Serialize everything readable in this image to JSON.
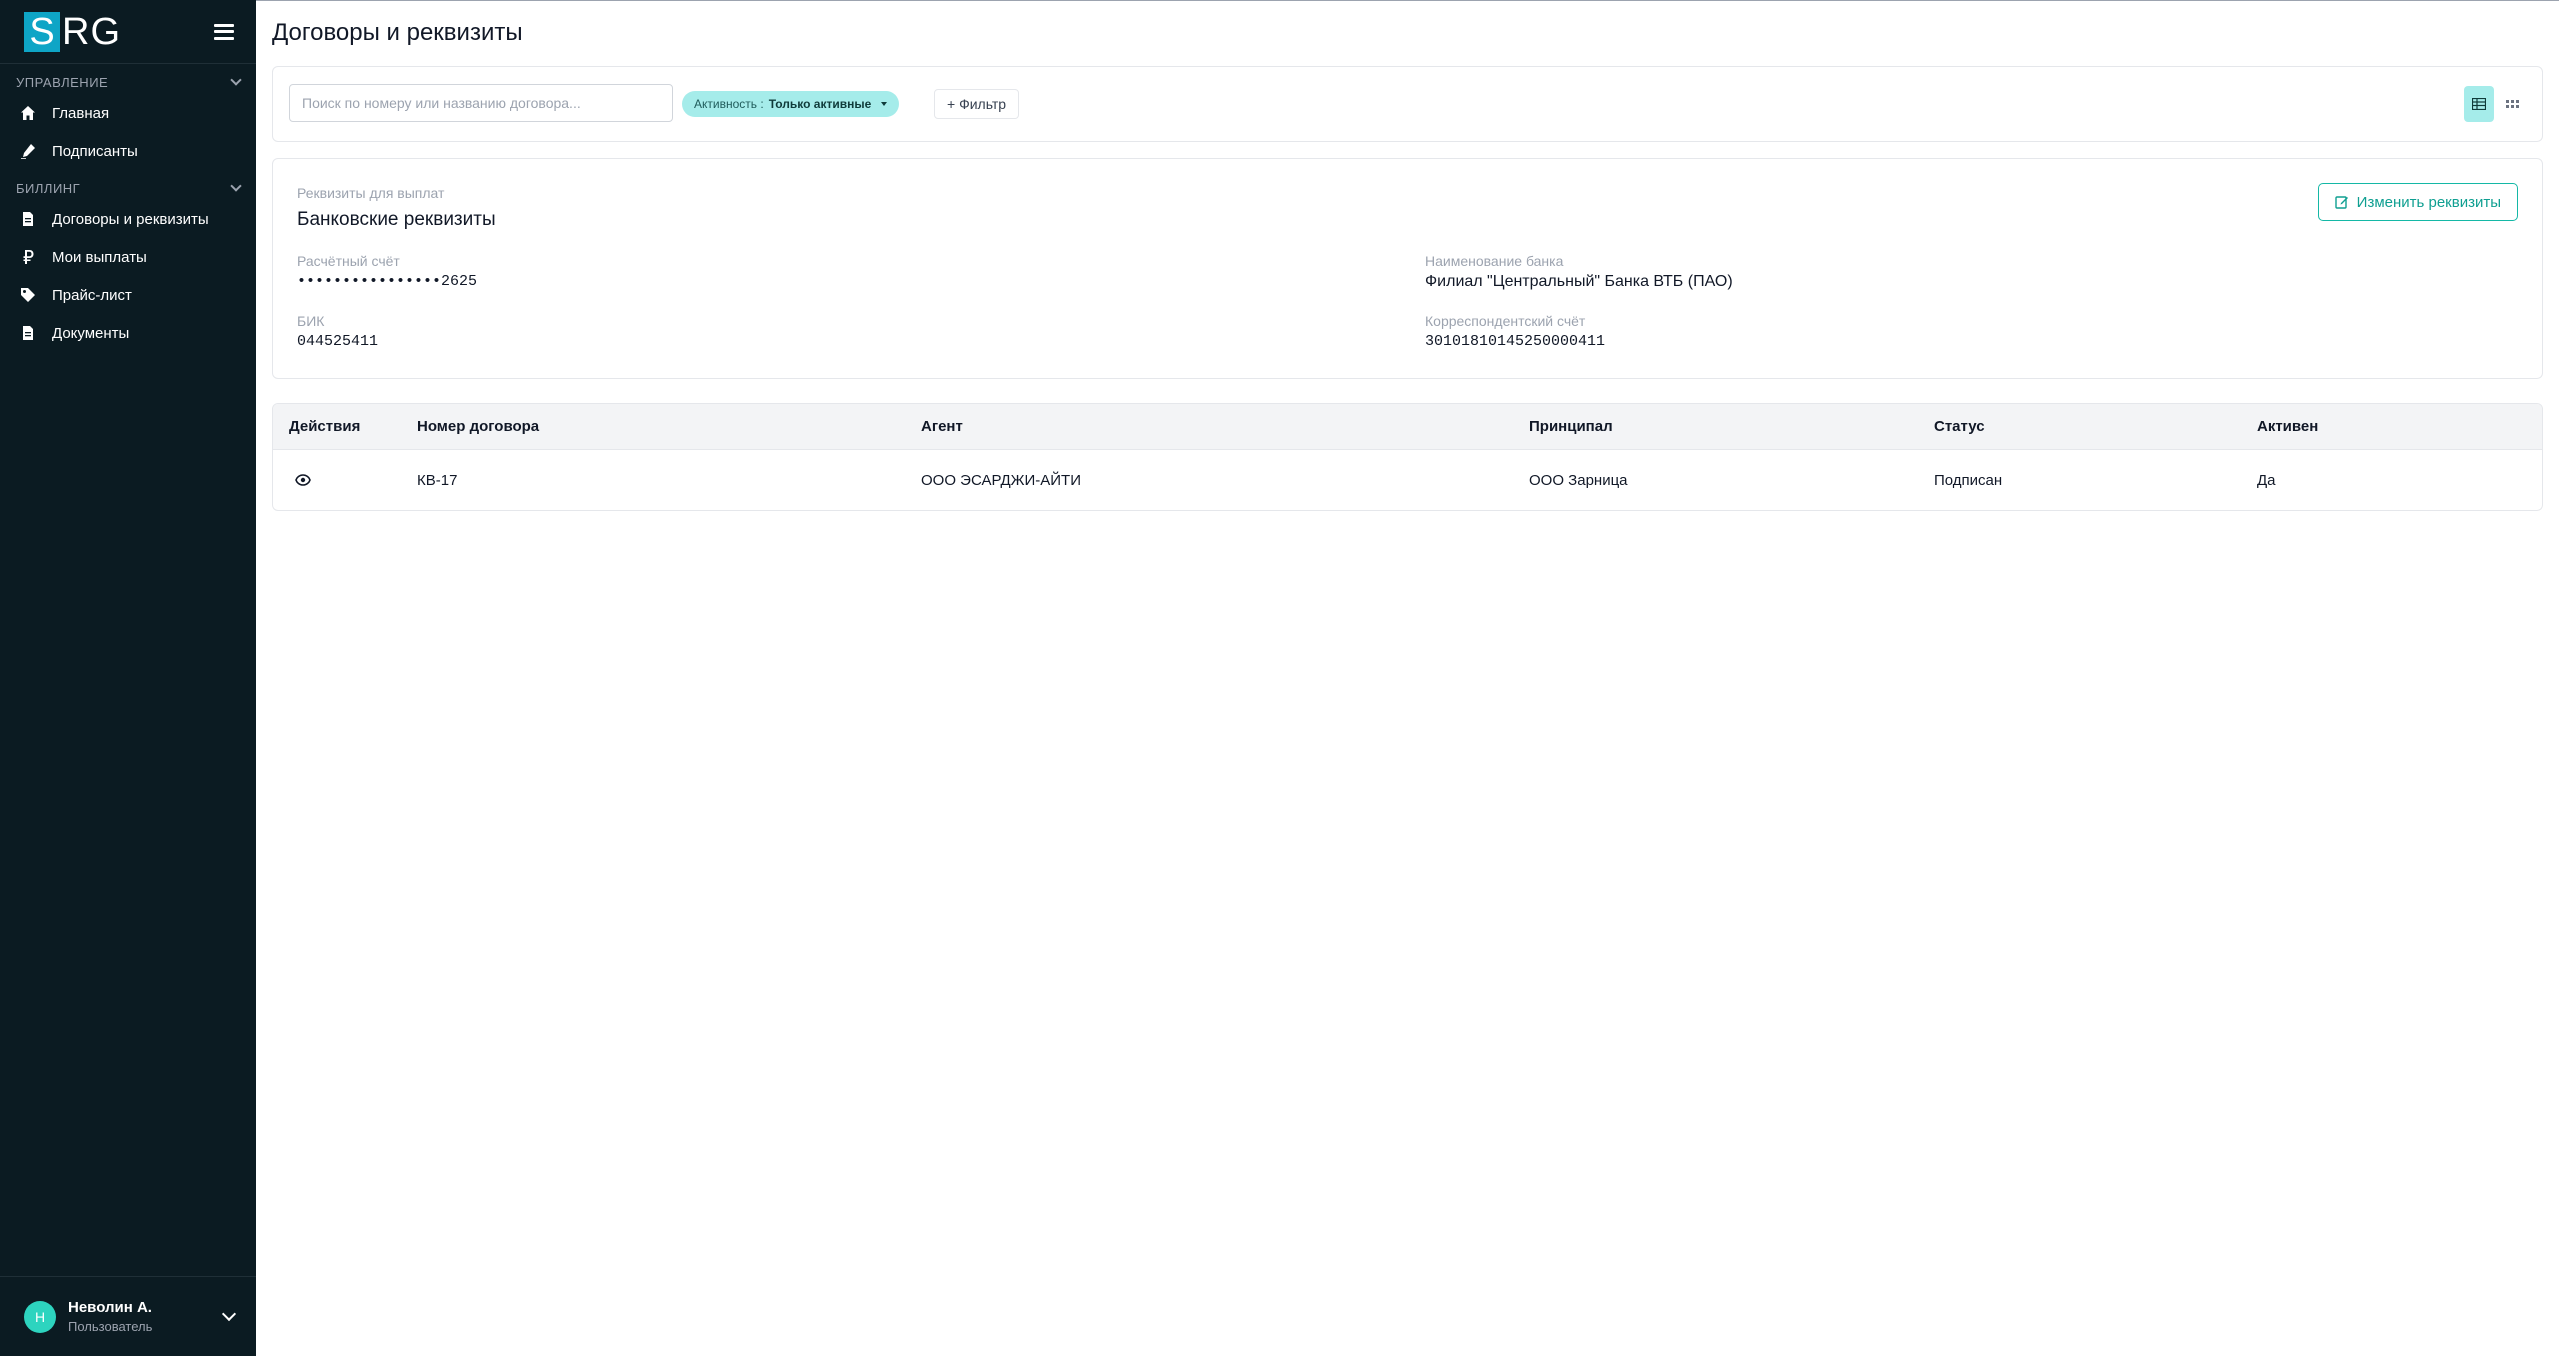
{
  "sidebar": {
    "logo": {
      "first": "S",
      "rest": "RG"
    },
    "sections": [
      {
        "title": "УПРАВЛЕНИЕ",
        "items": [
          {
            "label": "Главная",
            "icon": "home-icon"
          },
          {
            "label": "Подписанты",
            "icon": "signature-icon"
          }
        ]
      },
      {
        "title": "БИЛЛИНГ",
        "items": [
          {
            "label": "Договоры и реквизиты",
            "icon": "document-icon"
          },
          {
            "label": "Мои выплаты",
            "icon": "ruble-icon"
          },
          {
            "label": "Прайс-лист",
            "icon": "tag-icon"
          },
          {
            "label": "Документы",
            "icon": "document-icon"
          }
        ]
      }
    ],
    "user": {
      "initial": "Н",
      "name": "Неволин А.",
      "role": "Пользователь"
    }
  },
  "page": {
    "title": "Договоры и реквизиты"
  },
  "toolbar": {
    "search_placeholder": "Поиск по номеру или названию договора...",
    "chip": {
      "key": "Активность :",
      "value": "Только активные"
    },
    "filter_label": "+ Фильтр"
  },
  "requisites": {
    "subtitle": "Реквизиты для выплат",
    "title": "Банковские реквизиты",
    "edit_label": "Изменить реквизиты",
    "fields": {
      "account": {
        "label": "Расчётный счёт",
        "value": "••••••••••••••••2625"
      },
      "bank": {
        "label": "Наименование банка",
        "value": "Филиал \"Центральный\" Банка ВТБ (ПАО)"
      },
      "bik": {
        "label": "БИК",
        "value": "044525411"
      },
      "corr": {
        "label": "Корреспондентский счёт",
        "value": "30101810145250000411"
      }
    }
  },
  "table": {
    "headers": [
      "Действия",
      "Номер договора",
      "Агент",
      "Принципал",
      "Статус",
      "Активен"
    ],
    "rows": [
      {
        "number": "КВ-17",
        "agent": "ООО ЭСАРДЖИ-АЙТИ",
        "principal": "ООО Зарница",
        "status": "Подписан",
        "active": "Да"
      }
    ]
  },
  "colors": {
    "sidebar_bg": "#0b1b22",
    "accent": "#14b8a6",
    "chip_bg": "#a5ecea"
  }
}
